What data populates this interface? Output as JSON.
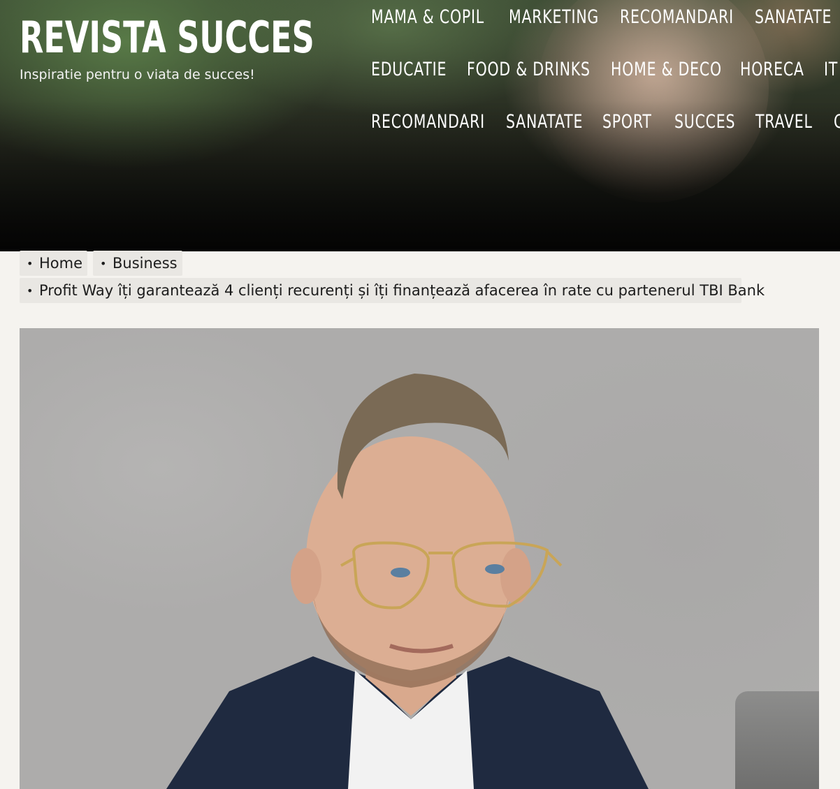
{
  "header": {
    "site_title": "REVISTA SUCCES",
    "tagline": "Inspiratie pentru o viata de succes!"
  },
  "nav": {
    "row1": [
      "MAMA & COPIL",
      "MARKETING",
      "RECOMANDARI",
      "SANATATE"
    ],
    "row2": [
      "EDUCATIE",
      "FOOD & DRINKS",
      "HOME & DECO",
      "HORECA",
      "IT"
    ],
    "row3": [
      "RECOMANDARI",
      "SANATATE",
      "SPORT",
      "SUCCES",
      "TRAVEL",
      "C"
    ]
  },
  "breadcrumb": {
    "home": "Home",
    "category": "Business",
    "current": "Profit Way îți garantează 4 clienți recurenți și îți finanțează afacerea în rate cu partenerul TBI Bank"
  },
  "colors": {
    "page_background": "#f5f3ef",
    "breadcrumb_background": "#e9e7e3",
    "header_text": "#ffffff"
  }
}
